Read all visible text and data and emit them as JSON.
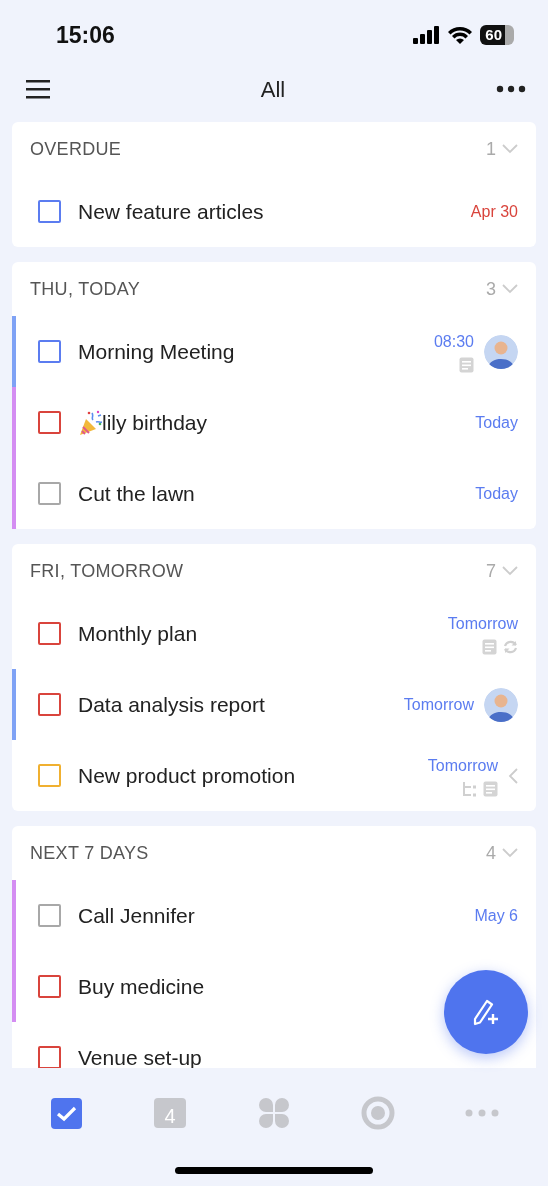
{
  "status_bar": {
    "time": "15:06",
    "battery": "60"
  },
  "header": {
    "title": "All"
  },
  "sections": [
    {
      "title": "OVERDUE",
      "count": "1",
      "expanded": true,
      "tasks": [
        {
          "title": "New feature articles",
          "checkbox": {
            "color": "#5b7cf0"
          },
          "due": {
            "text": "Apr 30",
            "color": "#d9443c"
          }
        }
      ]
    },
    {
      "title": "THU, TODAY",
      "count": "3",
      "expanded": true,
      "tasks": [
        {
          "title": "Morning Meeting",
          "checkbox": {
            "color": "#5b7cf0"
          },
          "due": {
            "text": "08:30",
            "color": "#5b7cf0"
          },
          "color": "#7fa2f5",
          "avatar": true,
          "note": true
        },
        {
          "title": "lily birthday",
          "checkbox": {
            "color": "#d9443c"
          },
          "due": {
            "text": "Today",
            "color": "#5b7cf0"
          },
          "color": "#d48df2",
          "party": true
        },
        {
          "title": "Cut the lawn",
          "checkbox": {
            "color": "#a8a8a8"
          },
          "due": {
            "text": "Today",
            "color": "#5b7cf0"
          },
          "color": "#d48df2"
        }
      ]
    },
    {
      "title": "FRI, TOMORROW",
      "count": "7",
      "expanded": true,
      "tasks": [
        {
          "title": "Monthly plan",
          "checkbox": {
            "color": "#d9443c"
          },
          "due": {
            "text": "Tomorrow",
            "color": "#5b7cf0"
          },
          "note": true,
          "repeat": true
        },
        {
          "title": "Data analysis report",
          "checkbox": {
            "color": "#d9443c"
          },
          "due": {
            "text": "Tomorrow",
            "color": "#5b7cf0"
          },
          "color": "#7fa2f5",
          "avatar": true
        },
        {
          "title": "New product promotion",
          "checkbox": {
            "color": "#f0b030"
          },
          "due": {
            "text": "Tomorrow",
            "color": "#5b7cf0"
          },
          "subtask": true,
          "note": true,
          "swipe": true
        }
      ]
    },
    {
      "title": "NEXT 7 DAYS",
      "count": "4",
      "expanded": true,
      "tasks": [
        {
          "title": "Call Jennifer",
          "checkbox": {
            "color": "#a8a8a8"
          },
          "due": {
            "text": "May 6",
            "color": "#5b7cf0"
          },
          "color": "#d48df2"
        },
        {
          "title": "Buy medicine",
          "checkbox": {
            "color": "#d9443c"
          },
          "color": "#d48df2"
        },
        {
          "title": "Venue set-up",
          "checkbox": {
            "color": "#d9443c"
          }
        }
      ]
    }
  ],
  "tabs": [
    {
      "kind": "tasks",
      "selected": true
    },
    {
      "kind": "calendar",
      "selected": false,
      "day": "4"
    },
    {
      "kind": "apps",
      "selected": false
    },
    {
      "kind": "focus",
      "selected": false
    },
    {
      "kind": "more",
      "selected": false
    }
  ]
}
